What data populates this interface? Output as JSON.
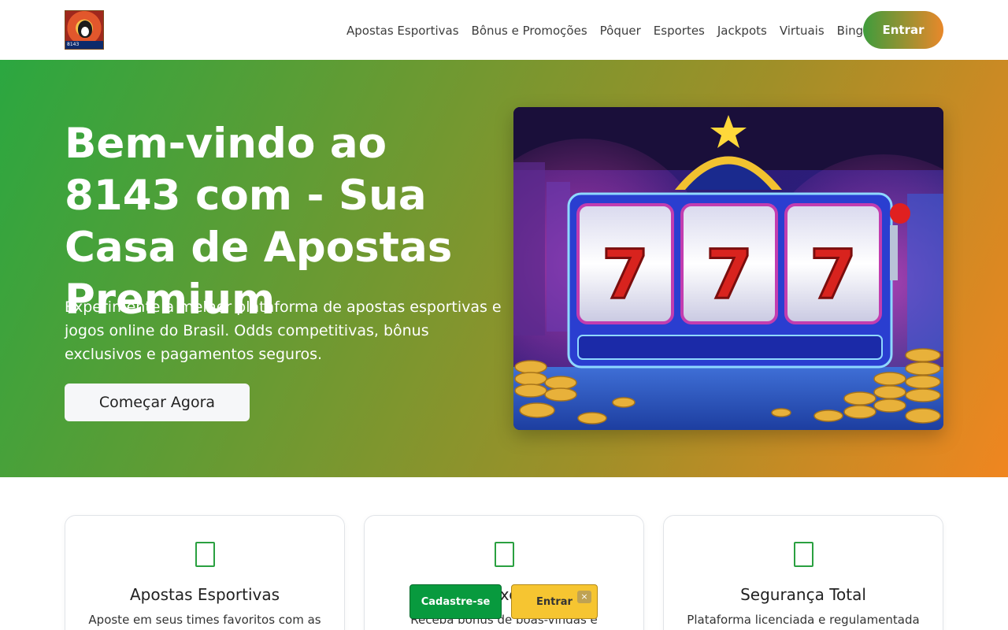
{
  "header": {
    "logo_text": "8143",
    "nav": [
      {
        "label": "Apostas Esportivas"
      },
      {
        "label": "Bônus e Promoções"
      },
      {
        "label": "Pôquer"
      },
      {
        "label": "Esportes"
      },
      {
        "label": "Jackpots"
      },
      {
        "label": "Virtuais"
      },
      {
        "label": "Bingo"
      }
    ],
    "enter_label": "Entrar"
  },
  "hero": {
    "title": "Bem-vindo ao 8143 com - Sua Casa de Apostas Premium",
    "description": "Experimente a melhor plataforma de apostas esportivas e jogos online do Brasil. Odds competitivas, bônus exclusivos e pagamentos seguros.",
    "cta_label": "Começar Agora"
  },
  "features": [
    {
      "title": "Apostas Esportivas",
      "text": "Aposte em seus times favoritos com as"
    },
    {
      "title": "Bônus Exclusivos",
      "text": "Receba bônus de boas-vindas e"
    },
    {
      "title": "Segurança Total",
      "text": "Plataforma licenciada e regulamentada"
    }
  ],
  "floating": {
    "signup_label": "Cadastre-se",
    "enter_label": "Entrar",
    "close_label": "×"
  },
  "colors": {
    "brand_green": "#2ba740",
    "brand_orange": "#f08620",
    "signup_green": "#089a3e",
    "enter_yellow": "#f6c531"
  }
}
